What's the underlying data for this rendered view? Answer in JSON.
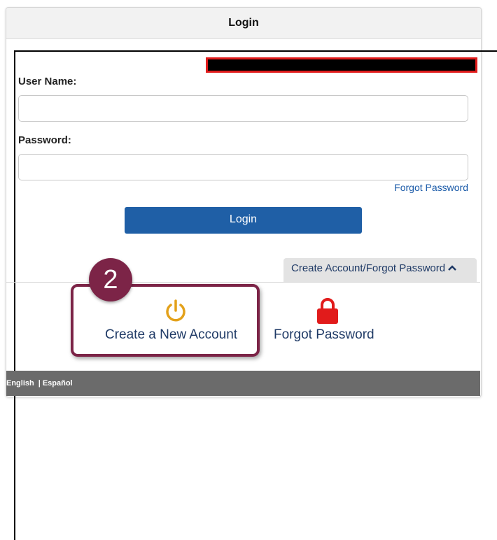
{
  "header": {
    "title": "Login"
  },
  "form": {
    "username_label": "User Name:",
    "username_value": "",
    "password_label": "Password:",
    "password_value": "",
    "forgot_link": "Forgot Password",
    "login_button": "Login"
  },
  "account_tab": {
    "label": "Create Account/Forgot Password"
  },
  "annotation": {
    "step": "2"
  },
  "options": {
    "create_label": "Create a New Account",
    "forgot_label": "Forgot Password"
  },
  "footer": {
    "lang_english": "English",
    "separator": "|",
    "lang_spanish": "Español"
  },
  "colors": {
    "accent": "#1f5fa6",
    "highlight": "#7c2447",
    "power_icon": "#e3a11a",
    "lock_icon": "#e11b1b"
  },
  "icons": {
    "create": "power-icon",
    "forgot": "lock-icon",
    "tab": "chevron-up-icon"
  }
}
